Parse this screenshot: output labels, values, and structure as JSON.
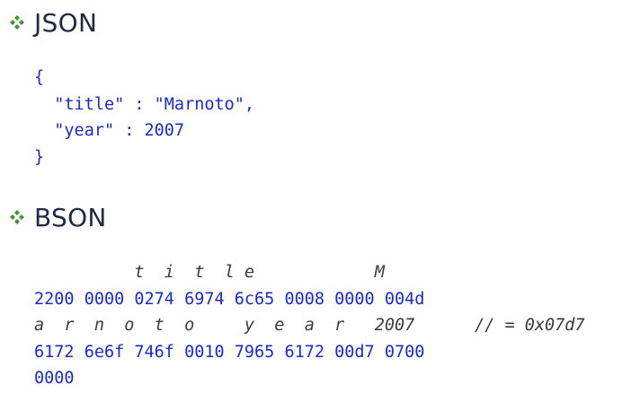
{
  "sections": [
    {
      "heading": "JSON",
      "code_lines": [
        "{",
        "  \"title\" : \"Marnoto\",",
        "  \"year\" : 2007",
        "}"
      ]
    },
    {
      "heading": "BSON",
      "lines": [
        {
          "kind": "annotation",
          "text": "          t  i  t  l e            M"
        },
        {
          "kind": "hex",
          "text": "2200 0000 0274 6974 6c65 0008 0000 004d"
        },
        {
          "kind": "annotation",
          "text": "a  r  n  o  t  o     y  e  a  r   2007      // = 0x07d7"
        },
        {
          "kind": "hex",
          "text": "6172 6e6f 746f 0010 7965 6172 00d7 0700"
        },
        {
          "kind": "hex",
          "text": "0000"
        }
      ]
    }
  ],
  "colors": {
    "bullet": "#3a9a2a",
    "heading": "#1f2a44",
    "code": "#1a2bd6",
    "annotation": "#3a3a3a"
  },
  "icons": {
    "bullet": "four-diamond-bullet-icon"
  }
}
